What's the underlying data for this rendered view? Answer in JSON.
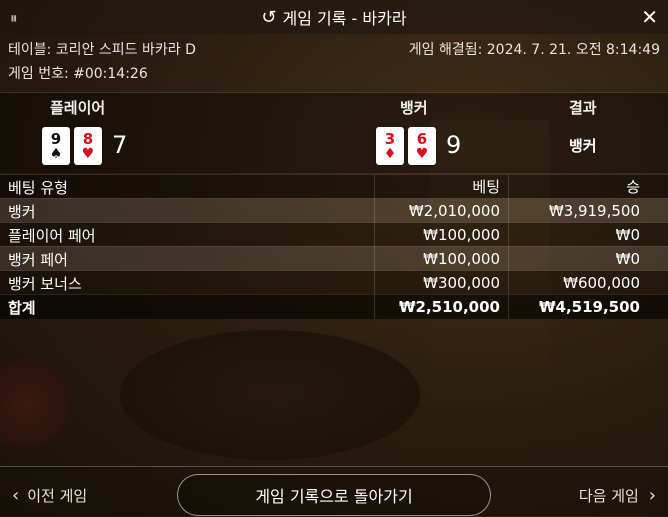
{
  "header": {
    "title": "게임 기록 - 바카라",
    "grip_icon": "⏸",
    "history_icon": "↺",
    "close_icon": "✕"
  },
  "info": {
    "table": "테이블: 코리안 스피드 바카라 D",
    "resolved": "게임 해결됨: 2024. 7. 21. 오전 8:14:49",
    "game_number": "게임 번호: #00:14:26"
  },
  "round": {
    "player_label": "플레이어",
    "banker_label": "뱅커",
    "result_label": "결과",
    "player_cards": [
      {
        "rank": "9",
        "suit": "♠",
        "color": "#111111"
      },
      {
        "rank": "8",
        "suit": "♥",
        "color": "#d8101e"
      }
    ],
    "player_score": "7",
    "banker_cards": [
      {
        "rank": "3",
        "suit": "♦",
        "color": "#d8101e"
      },
      {
        "rank": "6",
        "suit": "♥",
        "color": "#d8101e"
      }
    ],
    "banker_score": "9",
    "result": "뱅커"
  },
  "bets": {
    "headers": [
      "베팅 유형",
      "베팅",
      "승"
    ],
    "rows": [
      [
        "뱅커",
        "₩2,010,000",
        "₩3,919,500"
      ],
      [
        "플레이어 페어",
        "₩100,000",
        "₩0"
      ],
      [
        "뱅커 페어",
        "₩100,000",
        "₩0"
      ],
      [
        "뱅커 보너스",
        "₩300,000",
        "₩600,000"
      ]
    ],
    "total": [
      "합계",
      "₩2,510,000",
      "₩4,519,500"
    ]
  },
  "footer": {
    "prev": "이전 게임",
    "back": "게임 기록으로 돌아가기",
    "next": "다음 게임",
    "prev_icon": "‹",
    "next_icon": "›"
  }
}
